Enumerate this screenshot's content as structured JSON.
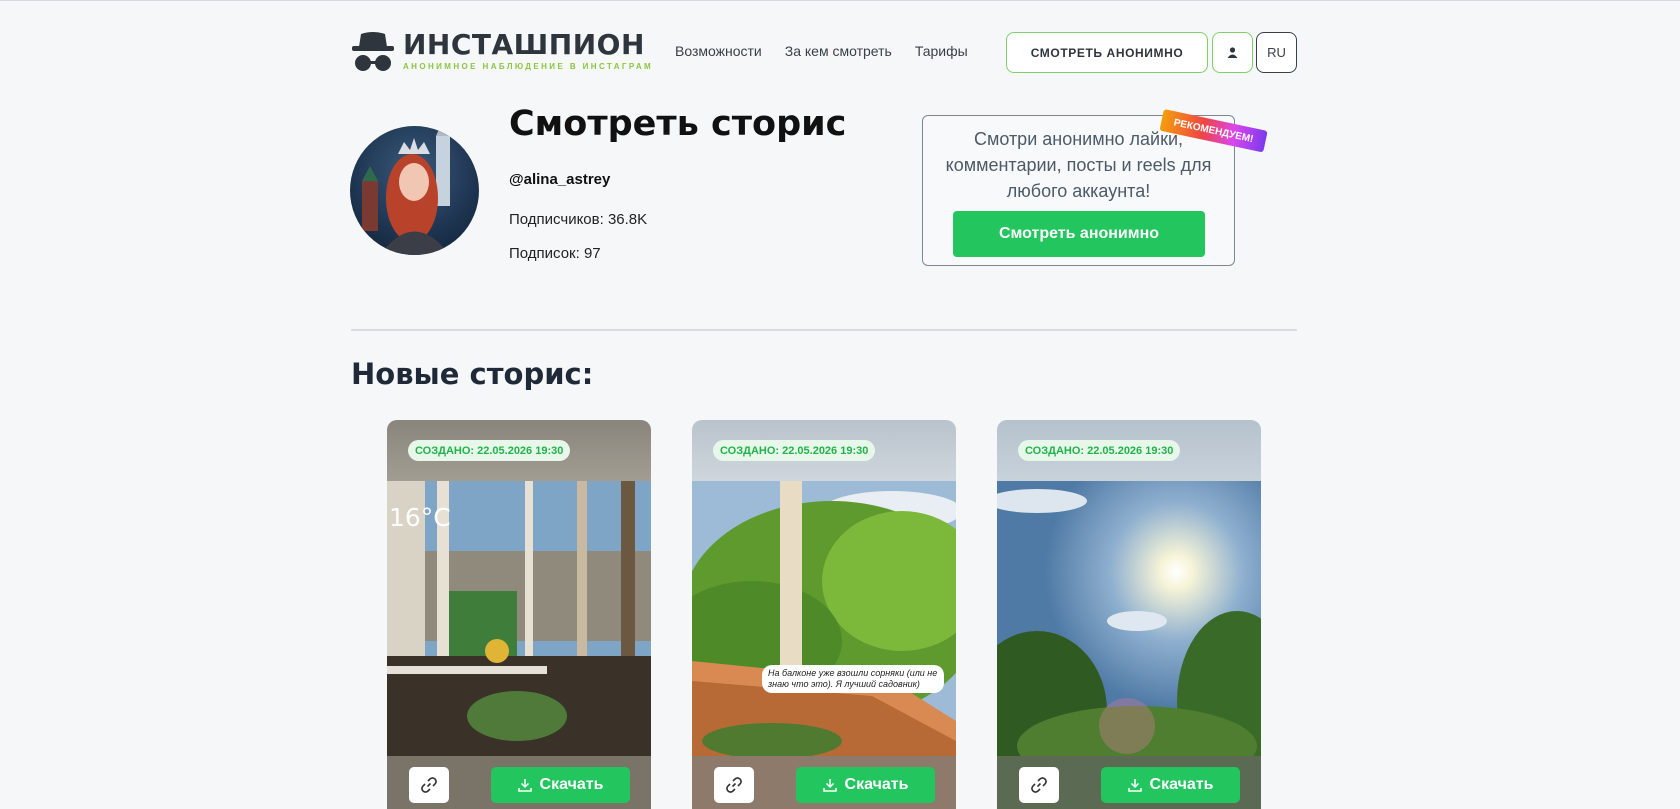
{
  "header": {
    "logo_title": "ИНСТАШПИОН",
    "logo_subtitle": "АНОНИМНОЕ НАБЛЮДЕНИЕ В ИНСТАГРАМ",
    "nav": [
      "Возможности",
      "За кем смотреть",
      "Тарифы"
    ],
    "cta_label": "СМОТРЕТЬ АНОНИМНО",
    "user_icon": "user-icon",
    "lang_label": "RU"
  },
  "profile": {
    "title": "Смотреть сторис",
    "username": "@alina_astrey",
    "followers": "Подписчиков: 36.8K",
    "following": "Подписок: 97"
  },
  "promo": {
    "text": "Смотри анонимно лайки, комментарии, посты и reels для любого аккаунта!",
    "button_label": "Смотреть анонимно",
    "ribbon": "РЕКОМЕНДУЕМ!"
  },
  "stories": {
    "section_title": "Новые сторис:",
    "items": [
      {
        "date": "СОЗДАНО: 22.05.2026 19:30",
        "overlay": "16°C",
        "download_label": "Скачать"
      },
      {
        "date": "СОЗДАНО: 22.05.2026 19:30",
        "caption": "На балконе уже взошли сорняки (или не знаю что это). Я лучший садовник)",
        "download_label": "Скачать"
      },
      {
        "date": "СОЗДАНО: 22.05.2026 19:30",
        "download_label": "Скачать"
      }
    ]
  },
  "colors": {
    "accent": "#22c55e",
    "brand_green": "#8cc63f"
  }
}
